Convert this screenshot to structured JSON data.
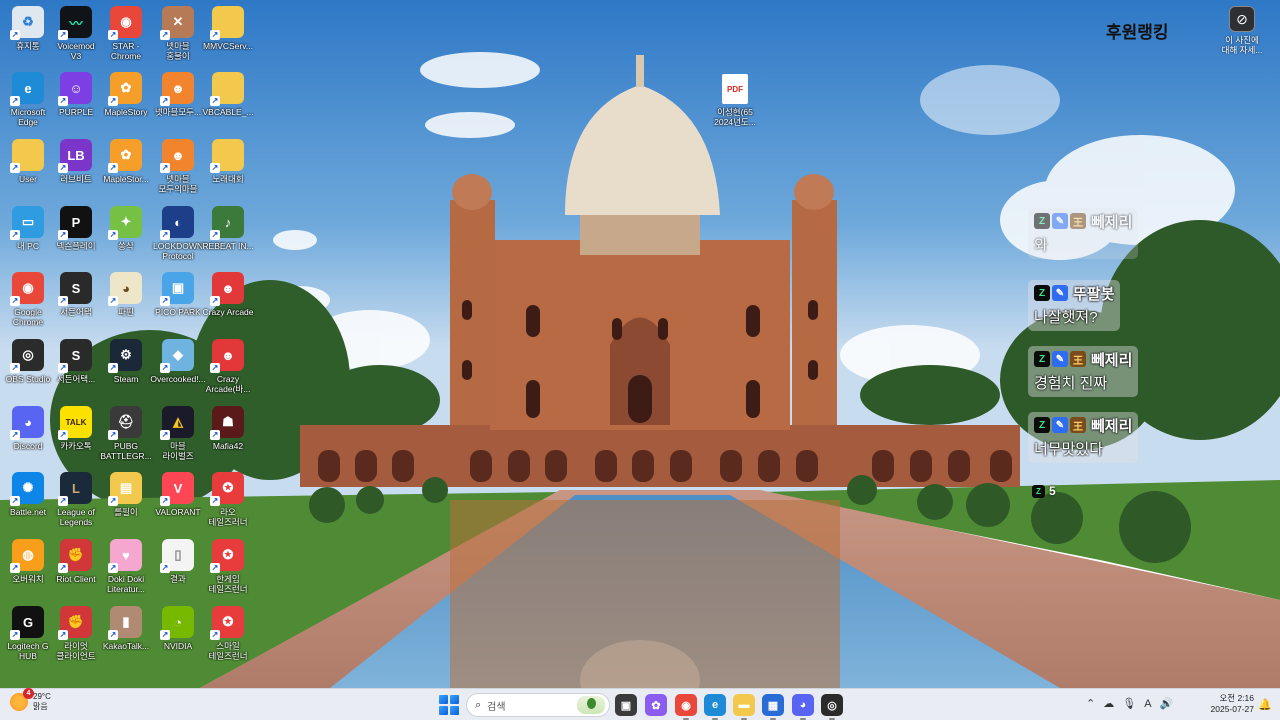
{
  "desktop": {
    "icons": [
      {
        "label": "휴지통",
        "glyph": "♻",
        "color": "#dfe8ef",
        "fg": "#2f7fd8",
        "icon": "recycle-bin-icon"
      },
      {
        "label": "Voicemod",
        "label2": "V3",
        "glyph": "〰",
        "color": "#101418",
        "fg": "#28e6a8",
        "icon": "voicemod-icon"
      },
      {
        "label": "STAR -",
        "label2": "Chrome",
        "glyph": "◉",
        "color": "#e9473a",
        "fg": "#fff",
        "icon": "chrome-icon"
      },
      {
        "label": "넷마블",
        "label2": "홈불이",
        "glyph": "✕",
        "color": "#b77a56",
        "fg": "#fff",
        "icon": "netmarble-icon"
      },
      {
        "label": "MMVCServ...",
        "glyph": "",
        "color": "#f2c94c",
        "fg": "#fff",
        "icon": "folder-icon"
      },
      {
        "label": "Microsoft",
        "label2": "Edge",
        "glyph": "e",
        "color": "#1f8ad6",
        "fg": "#fff",
        "icon": "edge-icon"
      },
      {
        "label": "PURPLE",
        "glyph": "☺",
        "color": "#7b3fe4",
        "fg": "#fff",
        "icon": "purple-icon"
      },
      {
        "label": "MapleStory",
        "glyph": "✿",
        "color": "#f59f2a",
        "fg": "#fff",
        "icon": "maplestory-icon"
      },
      {
        "label": "넷마블모두...",
        "glyph": "☻",
        "color": "#f2842e",
        "fg": "#fff",
        "icon": "netmarble-game-icon"
      },
      {
        "label": "VBCABLE_...",
        "glyph": "",
        "color": "#f2c94c",
        "fg": "#fff",
        "icon": "folder-icon"
      },
      {
        "label": "User",
        "glyph": "",
        "color": "#f2c94c",
        "fg": "#fff",
        "icon": "user-folder-icon"
      },
      {
        "label": "러브비트",
        "glyph": "LB",
        "color": "#7c35c9",
        "fg": "#fff",
        "icon": "lovebeat-icon"
      },
      {
        "label": "MapleStor...",
        "glyph": "✿",
        "color": "#f59f2a",
        "fg": "#fff",
        "icon": "maplestory-icon"
      },
      {
        "label": "넷마블",
        "label2": "모두의마블",
        "glyph": "☻",
        "color": "#f2842e",
        "fg": "#fff",
        "icon": "netmarble-game-icon"
      },
      {
        "label": "노래대회",
        "glyph": "",
        "color": "#f2c94c",
        "fg": "#fff",
        "icon": "folder-icon"
      },
      {
        "label": "내 PC",
        "glyph": "▭",
        "color": "#2f9be0",
        "fg": "#fff",
        "icon": "this-pc-icon"
      },
      {
        "label": "넥슨플레이",
        "glyph": "P",
        "color": "#111",
        "fg": "#fff",
        "icon": "nexon-play-icon"
      },
      {
        "label": "쏭삭",
        "glyph": "✦",
        "color": "#76c043",
        "fg": "#fff",
        "icon": "game-icon"
      },
      {
        "label": "LOCKDOWN",
        "label2": "Protocol",
        "glyph": "◐",
        "color": "#1d3f8a",
        "fg": "#fff",
        "icon": "lockdown-protocol-icon"
      },
      {
        "label": "REBEAT IN...",
        "glyph": "♪",
        "color": "#3b7a3a",
        "fg": "#fff",
        "icon": "rebeat-icon"
      },
      {
        "label": "Google",
        "label2": "Chrome",
        "glyph": "◉",
        "color": "#e9473a",
        "fg": "#fff",
        "icon": "chrome-icon"
      },
      {
        "label": "서든어택",
        "glyph": "S",
        "color": "#2a2a2a",
        "fg": "#fff",
        "icon": "sudden-attack-icon"
      },
      {
        "label": "파핀",
        "glyph": "◕",
        "color": "#eee6c8",
        "fg": "#6a4a1a",
        "icon": "game-icon"
      },
      {
        "label": "PICO PARK",
        "glyph": "▣",
        "color": "#4aa4e8",
        "fg": "#fff",
        "icon": "pico-park-icon"
      },
      {
        "label": "Crazy Arcade",
        "glyph": "☻",
        "color": "#e2383a",
        "fg": "#fff",
        "icon": "crazy-arcade-icon"
      },
      {
        "label": "OBS Studio",
        "glyph": "◎",
        "color": "#2b2b2b",
        "fg": "#fff",
        "icon": "obs-studio-icon"
      },
      {
        "label": "서든어택...",
        "glyph": "S",
        "color": "#2a2a2a",
        "fg": "#fff",
        "icon": "sudden-attack-icon"
      },
      {
        "label": "Steam",
        "glyph": "⚙",
        "color": "#1b2838",
        "fg": "#fff",
        "icon": "steam-icon"
      },
      {
        "label": "Overcooked!...",
        "glyph": "◆",
        "color": "#6fb3e0",
        "fg": "#fff",
        "icon": "overcooked-icon"
      },
      {
        "label": "Crazy",
        "label2": "Arcade(바...",
        "glyph": "☻",
        "color": "#e2383a",
        "fg": "#fff",
        "icon": "crazy-arcade-icon"
      },
      {
        "label": "Discord",
        "glyph": "◕",
        "color": "#5865f2",
        "fg": "#fff",
        "icon": "discord-icon"
      },
      {
        "label": "카카오톡",
        "glyph": "TALK",
        "color": "#fae100",
        "fg": "#3a1d1d",
        "icon": "kakaotalk-icon"
      },
      {
        "label": "PUBG",
        "label2": "BATTLEGR...",
        "glyph": "⛑",
        "color": "#3a3a3a",
        "fg": "#fff",
        "icon": "pubg-icon"
      },
      {
        "label": "마블",
        "label2": "라이벌즈",
        "glyph": "◭",
        "color": "#1a1a2a",
        "fg": "#f5c518",
        "icon": "marvel-rivals-icon"
      },
      {
        "label": "Mafia42",
        "glyph": "☗",
        "color": "#5a1a1a",
        "fg": "#fff",
        "icon": "mafia42-icon"
      },
      {
        "label": "Battle.net",
        "glyph": "✺",
        "color": "#0e86e8",
        "fg": "#fff",
        "icon": "battlenet-icon"
      },
      {
        "label": "League of",
        "label2": "Legends",
        "glyph": "L",
        "color": "#1a2a3a",
        "fg": "#c8aa6e",
        "icon": "league-of-legends-icon"
      },
      {
        "label": "롤필이",
        "glyph": "▤",
        "color": "#f2c94c",
        "fg": "#fff",
        "icon": "folder-icon"
      },
      {
        "label": "VALORANT",
        "glyph": "V",
        "color": "#ff4655",
        "fg": "#fff",
        "icon": "valorant-icon"
      },
      {
        "label": "라오",
        "label2": "테일즈러너",
        "glyph": "✪",
        "color": "#e83b3b",
        "fg": "#fff",
        "icon": "talesrunner-icon"
      },
      {
        "label": "오버워치",
        "glyph": "◍",
        "color": "#f99e1a",
        "fg": "#fff",
        "icon": "overwatch-icon"
      },
      {
        "label": "Riot Client",
        "glyph": "✊",
        "color": "#d13639",
        "fg": "#fff",
        "icon": "riot-client-icon"
      },
      {
        "label": "Doki Doki",
        "label2": "Literatur...",
        "glyph": "♥",
        "color": "#f6a7d0",
        "fg": "#fff",
        "icon": "doki-doki-icon"
      },
      {
        "label": "결과",
        "glyph": "▯",
        "color": "#f4f4f4",
        "fg": "#888",
        "icon": "file-icon"
      },
      {
        "label": "한게임",
        "label2": "테일즈런너",
        "glyph": "✪",
        "color": "#e83b3b",
        "fg": "#fff",
        "icon": "talesrunner-icon"
      },
      {
        "label": "Logitech G",
        "label2": "HUB",
        "glyph": "G",
        "color": "#111",
        "fg": "#fff",
        "icon": "logitech-g-hub-icon"
      },
      {
        "label": "라이엇",
        "label2": "클라이언트",
        "glyph": "✊",
        "color": "#d13639",
        "fg": "#fff",
        "icon": "riot-client-icon"
      },
      {
        "label": "KakaoTalk...",
        "glyph": "▮",
        "color": "#b08a72",
        "fg": "#fff",
        "icon": "kakaotalk-file-icon"
      },
      {
        "label": "NVIDIA",
        "glyph": "◔",
        "color": "#76b900",
        "fg": "#fff",
        "icon": "nvidia-icon"
      },
      {
        "label": "스마일",
        "label2": "테일즈런너",
        "glyph": "✪",
        "color": "#e83b3b",
        "fg": "#fff",
        "icon": "talesrunner-icon"
      }
    ],
    "pdf_file": {
      "label": "이성현(65",
      "label2": "2024년도...",
      "glyph": "PDF"
    }
  },
  "top_right": {
    "ranking_title": "후원랭킹",
    "info_label": "이 사진에",
    "info_label2": "대해 자세..."
  },
  "chat": {
    "messages": [
      {
        "user": "뻬제리",
        "text": "와",
        "badges": [
          "Z",
          "✎",
          "王"
        ],
        "faded": true
      },
      {
        "user": "뚜팔봇",
        "text": "나잘햇져?",
        "badges": [
          "Z",
          "✎"
        ],
        "faded": false
      },
      {
        "user": "뻬제리",
        "text": "경험치 진짜",
        "badges": [
          "Z",
          "✎",
          "王"
        ],
        "faded": false
      },
      {
        "user": "뻬제리",
        "text": "너무맛있다",
        "badges": [
          "Z",
          "✎",
          "王"
        ],
        "faded": false
      }
    ],
    "viewer_count": "5"
  },
  "taskbar": {
    "weather_temp": "29°C",
    "weather_desc": "맑음",
    "weather_alert": "4",
    "search_placeholder": "검색",
    "apps": [
      {
        "name": "task-view-icon",
        "glyph": "▣",
        "color": "#3a3a3a"
      },
      {
        "name": "copilot-icon",
        "glyph": "✿",
        "color": "#8a5cf0"
      },
      {
        "name": "chrome-taskbar-icon",
        "glyph": "◉",
        "color": "#e9473a"
      },
      {
        "name": "edge-taskbar-icon",
        "glyph": "e",
        "color": "#1f8ad6"
      },
      {
        "name": "file-explorer-icon",
        "glyph": "▬",
        "color": "#f2c94c"
      },
      {
        "name": "microsoft-store-icon",
        "glyph": "▦",
        "color": "#2a6cd6"
      },
      {
        "name": "discord-taskbar-icon",
        "glyph": "◕",
        "color": "#5865f2"
      },
      {
        "name": "obs-taskbar-icon",
        "glyph": "◎",
        "color": "#2b2b2b"
      }
    ],
    "tray_icons": [
      "⌃",
      "☁",
      "🎙",
      "A",
      "🔊"
    ],
    "clock_time": "오전 2:16",
    "clock_date": "2025-07-27"
  }
}
